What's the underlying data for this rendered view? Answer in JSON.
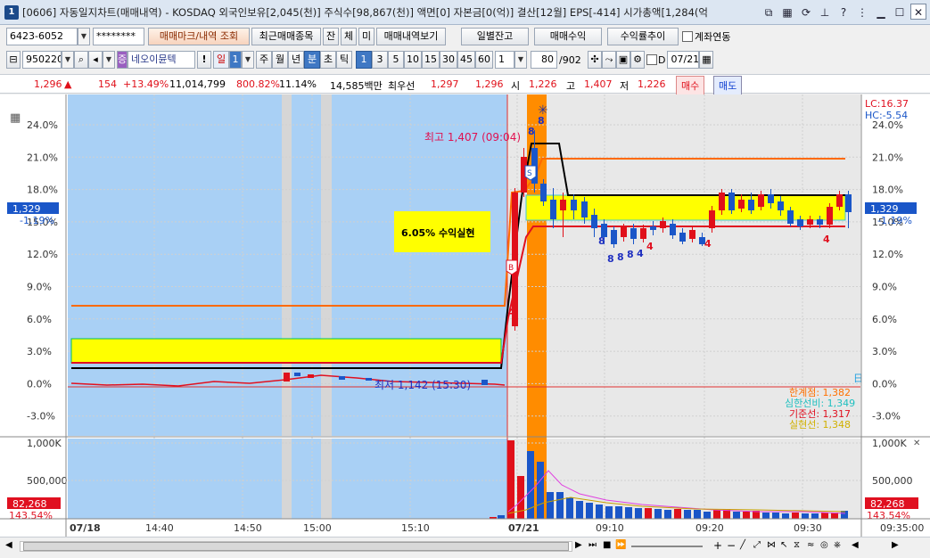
{
  "window": {
    "icon": "1",
    "title": "[0606] 자동일지차트(매매내역) - KOSDAQ 외국인보유[2,045(천)] 주식수[98,867(천)] 액면[0] 자본금[0(억)] 결산[12월] EPS[-414] 시가총액[1,284(억"
  },
  "toolbar1": {
    "account": "6423-6052",
    "password": "********",
    "btn_mark": "매매마크/내역 조회",
    "btn_recent": "최근매매종목",
    "b_jan": "잔",
    "b_che": "체",
    "b_mi": "미",
    "btn_history": "매매내역보기",
    "btn_daily": "일별잔고",
    "btn_profit": "매매수익",
    "btn_return": "수익률추이",
    "chk_link": "계좌연동"
  },
  "toolbar2": {
    "code": "950220",
    "stock_name": "네오이뮨텍",
    "period": [
      "일",
      "1",
      "주",
      "월",
      "년",
      "분",
      "초",
      "틱"
    ],
    "intervals": [
      "1",
      "3",
      "5",
      "10",
      "15",
      "30",
      "45",
      "60"
    ],
    "count": "1",
    "view": "80",
    "total": "/902",
    "date": "07/21",
    "chk_d": "D"
  },
  "quote": {
    "price": "1,296",
    "arrow": "▲",
    "change": "154",
    "change_pct": "+13.49%",
    "volume": "11,014,799",
    "vol_ratio": "800.82%",
    "turnover": "11.14%",
    "amount": "14,585백만",
    "best_label": "최우선",
    "best_ask": "1,297",
    "best_bid": "1,296",
    "open_label": "시",
    "open": "1,226",
    "high_label": "고",
    "high": "1,407",
    "low_label": "저",
    "low": "1,226",
    "sell": "매수",
    "buy": "매도"
  },
  "chart": {
    "y_ticks": [
      "24.0%",
      "21.0%",
      "18.0%",
      "15.0%",
      "12.0%",
      "9.0%",
      "6.0%",
      "3.0%",
      "0.0%",
      "-3.0%"
    ],
    "vol_ticks": [
      "1,000K",
      "500,000"
    ],
    "x_labels": [
      "07/18",
      "14:40",
      "14:50",
      "15:00",
      "15:10",
      "07/21",
      "09:10",
      "09:20",
      "09:30",
      "09:35:00"
    ],
    "lc": "LC:16.37",
    "hc": "HC:-5.54",
    "cur_price": "1,329",
    "cur_pct": "-1.19%",
    "vol_value": "82,268",
    "vol_pct": "143.54%",
    "high_note": "최고 1,407 (09:04)",
    "low_note": "최저 1,142 (15:30)",
    "profit_box": "6.05% 수익실현",
    "legend": [
      "한계점: 1,382",
      "심한선비: 1,349",
      "기준선: 1,317",
      "실현선: 1,348"
    ],
    "mark_B": "B",
    "mark_S": "S",
    "mark_day": "日",
    "signals": [
      "8",
      "8",
      "4",
      "8",
      "8",
      "8",
      "8",
      "4",
      "4",
      "4",
      "4"
    ],
    "colors": {
      "up": "#e0101a",
      "down": "#1a56c8",
      "bg_prev": "#a9d0f5",
      "highlight": "#ff8c00",
      "band": "#ffff00"
    }
  },
  "scrollbar": {
    "zoom_plus": "+",
    "zoom_minus": "−"
  }
}
